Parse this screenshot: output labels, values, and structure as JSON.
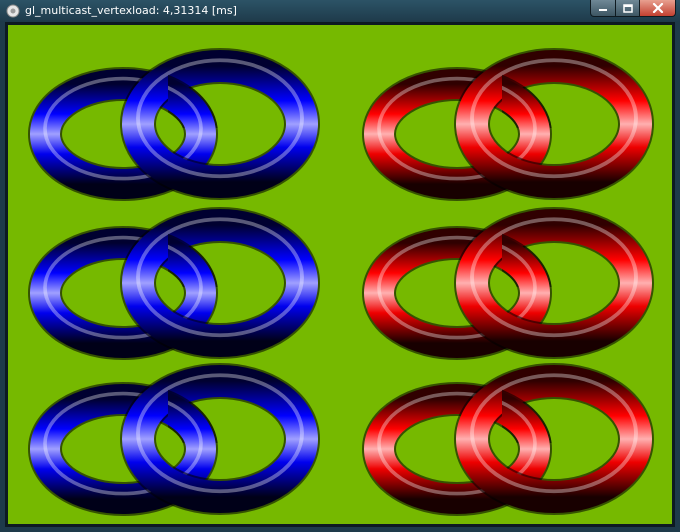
{
  "window": {
    "title": "gl_multicast_vertexload: 4,31314 [ms]",
    "icons": {
      "app": "gl-app-icon",
      "minimize": "minimize-icon",
      "maximize": "maximize-icon",
      "close": "close-icon"
    }
  },
  "viewport": {
    "background_color": "#76b900",
    "views": [
      {
        "name": "left-view",
        "torus_color": "blue",
        "rows": 3
      },
      {
        "name": "right-view",
        "torus_color": "red",
        "rows": 3
      }
    ]
  }
}
